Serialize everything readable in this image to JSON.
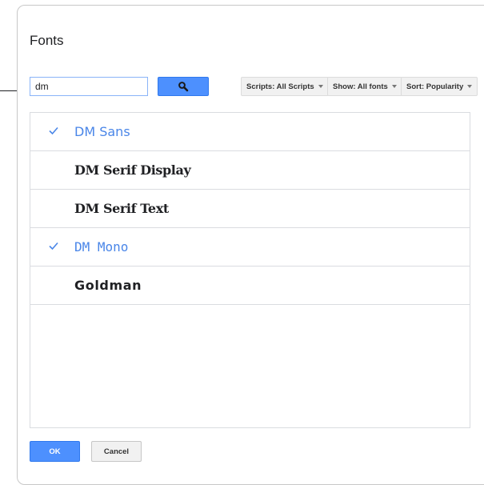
{
  "dialog": {
    "title": "Fonts"
  },
  "search": {
    "value": "dm",
    "placeholder": ""
  },
  "filters": {
    "scripts_label": "Scripts: All Scripts",
    "show_label": "Show: All fonts",
    "sort_label": "Sort: Popularity"
  },
  "fonts": [
    {
      "label": "DM Sans",
      "selected": true
    },
    {
      "label": "DM Serif Display",
      "selected": false
    },
    {
      "label": "DM Serif Text",
      "selected": false
    },
    {
      "label": "DM Mono",
      "selected": true
    },
    {
      "label": "Goldman",
      "selected": false
    }
  ],
  "footer": {
    "ok_label": "OK",
    "cancel_label": "Cancel"
  },
  "colors": {
    "accent": "#4d90fe",
    "selected_text": "#4a86e8",
    "check": "#4a86e8"
  },
  "icons": {
    "search": "search-icon",
    "check": "check-icon",
    "dropdown": "chevron-down-icon"
  }
}
